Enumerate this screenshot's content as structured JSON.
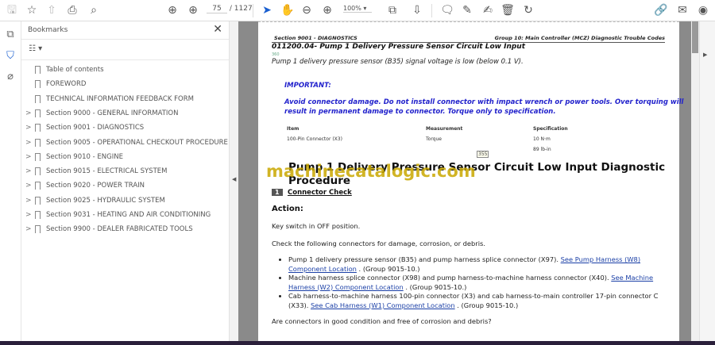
{
  "toolbar": {
    "page_current": "75",
    "page_total": "/ 1127",
    "zoom": "100%"
  },
  "panel": {
    "title": "Bookmarks",
    "items": [
      {
        "label": "Table of contents",
        "expandable": false
      },
      {
        "label": "FOREWORD",
        "expandable": false
      },
      {
        "label": "TECHNICAL INFORMATION FEEDBACK FORM",
        "expandable": false
      },
      {
        "label": "Section 9000 - GENERAL INFORMATION",
        "expandable": true
      },
      {
        "label": "Section 9001 - DIAGNOSTICS",
        "expandable": true
      },
      {
        "label": "Section 9005 - OPERATIONAL CHECKOUT PROCEDURE",
        "expandable": true
      },
      {
        "label": "Section 9010 - ENGINE",
        "expandable": true
      },
      {
        "label": "Section 9015 - ELECTRICAL SYSTEM",
        "expandable": true
      },
      {
        "label": "Section 9020 - POWER TRAIN",
        "expandable": true
      },
      {
        "label": "Section 9025 - HYDRAULIC SYSTEM",
        "expandable": true
      },
      {
        "label": "Section 9031 - HEATING AND AIR CONDITIONING",
        "expandable": true
      },
      {
        "label": "Section 9900 - DEALER FABRICATED TOOLS",
        "expandable": true
      }
    ]
  },
  "doc": {
    "header_left": "Section 9001 - DIAGNOSTICS",
    "header_right": "Group 10: Main Controller (MCZ) Diagnostic Trouble Codes",
    "code_title": "011200.04- Pump 1 Delivery Pressure Sensor Circuit Low Input",
    "small_num": "360",
    "description": "Pump 1 delivery pressure sensor (B35) signal voltage is low (below 0.1 V).",
    "important_label": "IMPORTANT:",
    "important_text1": "Avoid connector damage. Do not install connector with impact wrench or power tools. Over torquing will",
    "important_text2": "result in permanent damage to connector. Torque only to specification.",
    "table": {
      "headers": [
        "Item",
        "Measurement",
        "Specification"
      ],
      "row": [
        "100-Pin Connector (X3)",
        "Torque",
        "10 N·m"
      ],
      "row2_spec": "89 lb-in"
    },
    "page_marker": "355",
    "proc_title1": "Pump 1 Delivery Pressure Sensor Circuit Low Input Diagnostic",
    "proc_title2": "Procedure",
    "step_num": "1",
    "step_title": "Connector Check",
    "action_label": "Action:",
    "p1": "Key switch in OFF position.",
    "p2": "Check the following connectors for damage, corrosion, or debris.",
    "bullets": [
      {
        "text": "Pump 1 delivery pressure sensor (B35) and pump harness splice connector (X97). ",
        "link": "See Pump Harness (W8) Component Location",
        "after": " . (Group 9015-10.)"
      },
      {
        "text": "Machine harness splice connector (X98) and pump harness-to-machine harness connector (X40). ",
        "link": "See Machine Harness (W2) Component Location",
        "after": " . (Group 9015-10.)"
      },
      {
        "text": "Cab harness-to-machine harness 100-pin connector (X3) and cab harness-to-main controller 17-pin connector C (X33). ",
        "link": "See Cab Harness (W1) Component Location",
        "after": " . (Group 9015-10.)"
      }
    ],
    "question": "Are connectors in good condition and free of corrosion and debris?",
    "watermark": "machinecatalogic.com"
  }
}
